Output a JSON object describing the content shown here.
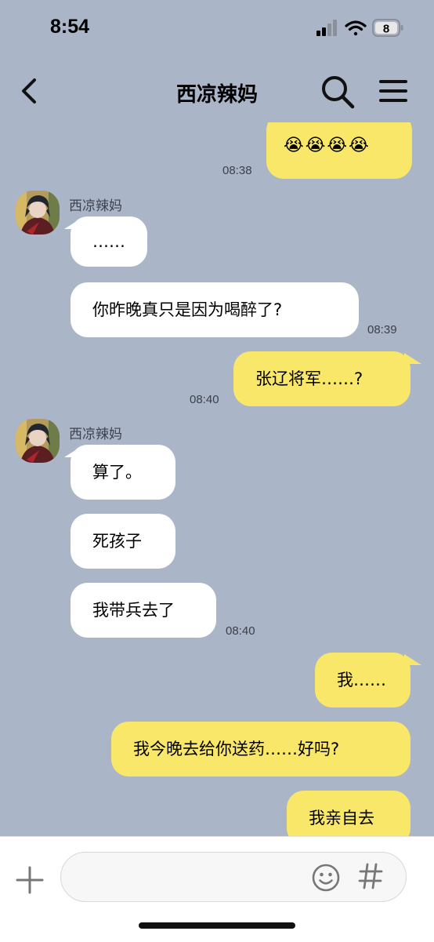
{
  "status_bar": {
    "time": "8:54",
    "battery": "8",
    "icons": [
      "signal-icon",
      "wifi-icon",
      "battery-icon"
    ]
  },
  "header": {
    "title": "西凉辣妈",
    "icons": [
      "back-arrow-icon",
      "search-icon",
      "menu-icon"
    ]
  },
  "messages": [
    {
      "side": "out",
      "text": "😭😭😭😭",
      "time": "08:38"
    },
    {
      "side": "in",
      "sender": "西凉辣妈",
      "text": "……"
    },
    {
      "side": "in",
      "text": "你昨晚真只是因为喝醉了?",
      "time": "08:39"
    },
    {
      "side": "out",
      "text": "张辽将军……?",
      "time": "08:40"
    },
    {
      "side": "in",
      "sender": "西凉辣妈",
      "text": "算了。"
    },
    {
      "side": "in",
      "text": "死孩子"
    },
    {
      "side": "in",
      "text": "我带兵去了",
      "time": "08:40"
    },
    {
      "side": "out",
      "text": "我……"
    },
    {
      "side": "out",
      "text": "我今晚去给你送药……好吗?"
    },
    {
      "side": "out",
      "text": "我亲自去"
    }
  ],
  "input_bar": {
    "placeholder": "",
    "icons": [
      "plus-icon",
      "emoji-icon",
      "hashtag-icon"
    ]
  },
  "colors": {
    "background": "#aab5c8",
    "incoming_bubble": "#ffffff",
    "outgoing_bubble": "#f9e769"
  }
}
